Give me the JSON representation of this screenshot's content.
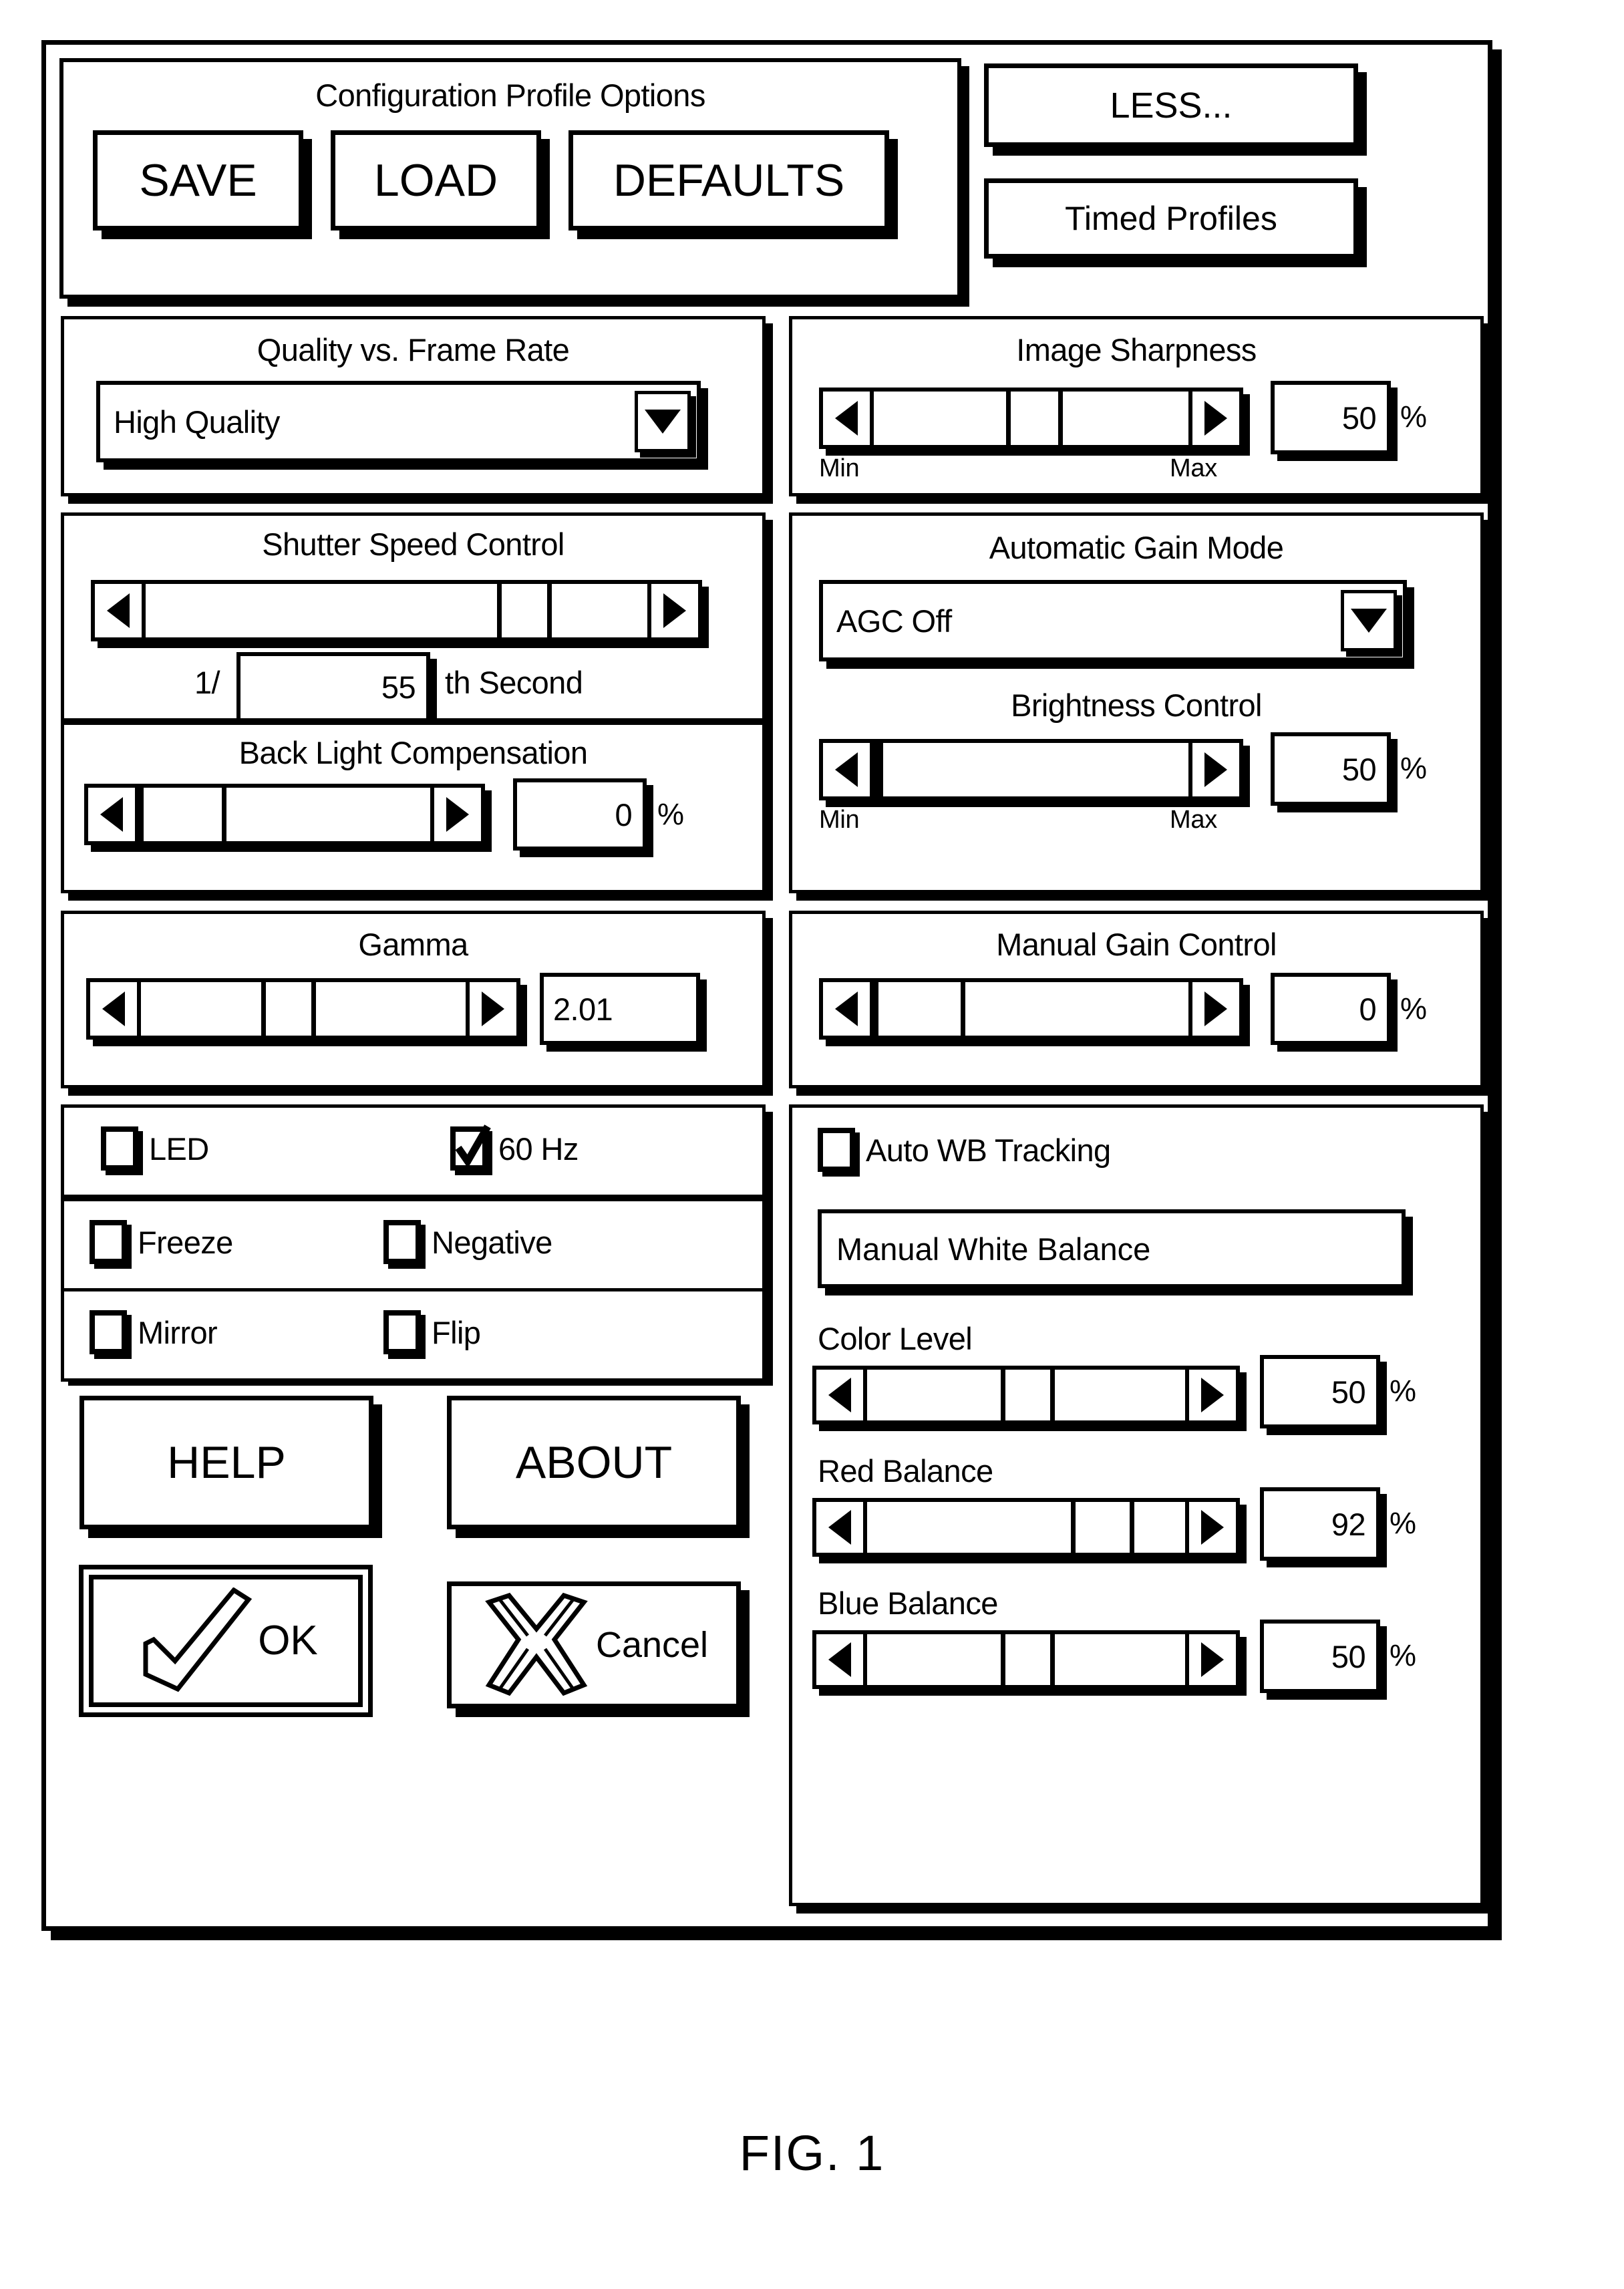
{
  "dialog": {
    "profile_group": {
      "title": "Configuration Profile Options",
      "buttons": [
        {
          "label": "SAVE",
          "name": "save-button"
        },
        {
          "label": "LOAD",
          "name": "load-button"
        },
        {
          "label": "DEFAULTS",
          "name": "defaults-button"
        }
      ]
    },
    "top_right_buttons": [
      {
        "label": "LESS...",
        "name": "less-button"
      },
      {
        "label": "Timed Profiles",
        "name": "timed-profiles-button"
      }
    ],
    "quality": {
      "title": "Quality vs. Frame Rate",
      "selected": "High Quality",
      "arrow_icon": "chevron-down-icon"
    },
    "sharpness": {
      "title": "Image Sharpness",
      "min_label": "Min",
      "max_label": "Max",
      "value": "50",
      "unit": "%",
      "thumb_percent": 50
    },
    "shutter": {
      "title": "Shutter Speed Control",
      "prefix": "1/",
      "value": "55",
      "suffix": "th Second",
      "thumb_percent": 72
    },
    "backlight": {
      "title": "Back Light Compensation",
      "value": "0",
      "unit": "%",
      "thumb_percent": 4
    },
    "agc": {
      "title": "Automatic Gain Mode",
      "selected": "AGC Off",
      "arrow_icon": "chevron-down-icon"
    },
    "brightness": {
      "title": "Brightness Control",
      "min_label": "Min",
      "max_label": "Max",
      "value": "50",
      "unit": "%",
      "thumb_percent": 0
    },
    "gamma": {
      "title": "Gamma",
      "value": "2.01",
      "thumb_percent": 46
    },
    "manual_gain": {
      "title": "Manual Gain Control",
      "value": "0",
      "unit": "%",
      "thumb_percent": 6
    },
    "checkboxes": [
      {
        "label": "LED",
        "checked": false,
        "name": "checkbox-led"
      },
      {
        "label": "60 Hz",
        "checked": true,
        "name": "checkbox-60hz"
      },
      {
        "label": "Freeze",
        "checked": false,
        "name": "checkbox-freeze"
      },
      {
        "label": "Negative",
        "checked": false,
        "name": "checkbox-negative"
      },
      {
        "label": "Mirror",
        "checked": false,
        "name": "checkbox-mirror"
      },
      {
        "label": "Flip",
        "checked": false,
        "name": "checkbox-flip"
      }
    ],
    "white_balance": {
      "auto_label": "Auto WB Tracking",
      "auto_checked": false,
      "manual_button": "Manual White Balance"
    },
    "color_level": {
      "title": "Color Level",
      "value": "50",
      "unit": "%",
      "thumb_percent": 50
    },
    "red_balance": {
      "title": "Red Balance",
      "value": "92",
      "unit": "%",
      "thumb_percent": 87
    },
    "blue_balance": {
      "title": "Blue Balance",
      "value": "50",
      "unit": "%",
      "thumb_percent": 50
    },
    "bottom_buttons": {
      "help": "HELP",
      "about": "ABOUT",
      "ok": "OK",
      "cancel": "Cancel",
      "ok_icon": "checkmark-icon",
      "cancel_icon": "x-mark-icon"
    }
  },
  "figure_caption": "FIG. 1"
}
